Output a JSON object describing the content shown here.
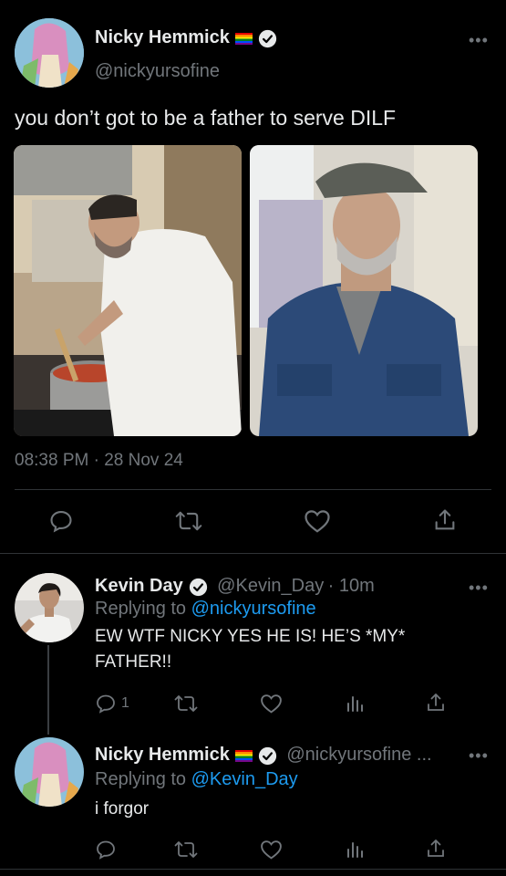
{
  "main_tweet": {
    "author": "Nicky Hemmick",
    "handle": "@nickyursofine",
    "text": "you don’t got to be a father to serve DILF",
    "timestamp": "08:38 PM · 28 Nov 24",
    "more": "•••"
  },
  "reply1": {
    "author": "Kevin Day",
    "handle": "@Kevin_Day",
    "time": "· 10m",
    "replying_prefix": "Replying to",
    "replying_to": "@nickyursofine",
    "text": "EW WTF NICKY YES HE IS! HE’S *MY* FATHER!!",
    "reply_count": "1",
    "more": "•••"
  },
  "reply2": {
    "author": "Nicky Hemmick",
    "handle": "@nickyursofine ...",
    "replying_prefix": "Replying to",
    "replying_to": "@Kevin_Day",
    "text": "i forgor",
    "more": "•••"
  },
  "icons": [
    "reply-icon",
    "retweet-icon",
    "like-icon",
    "analytics-icon",
    "share-icon",
    "verified-icon",
    "pride-flag-icon"
  ],
  "colors": {
    "background": "#000000",
    "text": "#e7e9ea",
    "muted": "#71767b",
    "link": "#1d9bf0",
    "separator": "#2f3336"
  }
}
